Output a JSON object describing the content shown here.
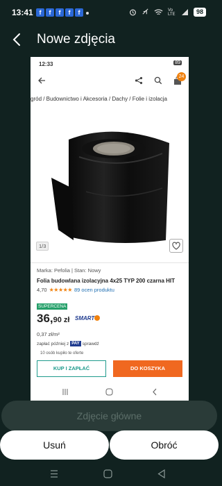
{
  "status_bar": {
    "time": "13:41",
    "notification_icons": [
      "f",
      "f",
      "f",
      "f",
      "f"
    ],
    "battery": "98",
    "signal_label": "Vo LTE"
  },
  "app_bar": {
    "title": "Nowe zdjęcia"
  },
  "screenshot": {
    "status": {
      "time": "12:33",
      "battery": "89"
    },
    "cart_count": "24",
    "breadcrumb": "gród  /  Budownictwo i Akcesoria  /  Dachy  /  Folie i izolacja",
    "image_counter": "1/3",
    "brand_line": "Marka: Pefolia | Stan: Nowy",
    "product_name": "Folia budowlana izolacyjna 4x25 TYP 200 czarna HIT",
    "rating": "4,70",
    "stars": "★★★★★",
    "reviews": "89 ocen produktu",
    "badge": "SUPERCENA",
    "price_main": "36,",
    "price_fraction": "90 zł",
    "smart_label": "SMART",
    "price_per_m2": "0,37 zł/m²",
    "pay_later_prefix": "zapłać później z",
    "pay_brand": "PAY",
    "pay_later_suffix": "sprawdź",
    "buyers_info": "10 osób kupiło te oferte",
    "buy_now": "KUP I ZAPŁAĆ",
    "add_to_cart": "DO KOSZYKA"
  },
  "actions": {
    "main_photo": "Zdjęcie główne",
    "remove": "Usuń",
    "rotate": "Obróć"
  },
  "colors": {
    "background": "#112220",
    "teal": "#1e9a8c",
    "orange": "#f06820",
    "supercena": "#25a06a"
  }
}
